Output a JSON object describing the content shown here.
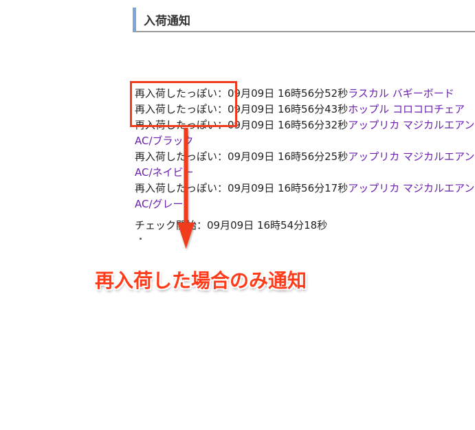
{
  "header": {
    "title": "入荷通知"
  },
  "notices": [
    {
      "status": "再入荷したっぽい：",
      "time": "09月09日 16時56分52秒",
      "product": "ラスカル バギーボード"
    },
    {
      "status": "再入荷したっぽい：",
      "time": "09月09日 16時56分43秒",
      "product": "ホップル コロコロチェア"
    },
    {
      "status": "再入荷したっぽい：",
      "time": "09月09日 16時56分32秒",
      "product": "アップリカ マジカルエアンAC/ブラック"
    },
    {
      "status": "再入荷したっぽい：",
      "time": "09月09日 16時56分25秒",
      "product": "アップリカ マジカルエアンAC/ネイビー"
    },
    {
      "status": "再入荷したっぽい：",
      "time": "09月09日 16時56分17秒",
      "product": "アップリカ マジカルエアンAC/グレー"
    }
  ],
  "check": {
    "label": "チェック開始：",
    "time": "09月09日 16時54分18秒"
  },
  "annotation": {
    "text": "再入荷した場合のみ通知",
    "color": "#ff3b1a"
  },
  "colors": {
    "header_accent": "#7aa7d6",
    "link": "#6a1fb0",
    "highlight": "#f03a1e"
  }
}
